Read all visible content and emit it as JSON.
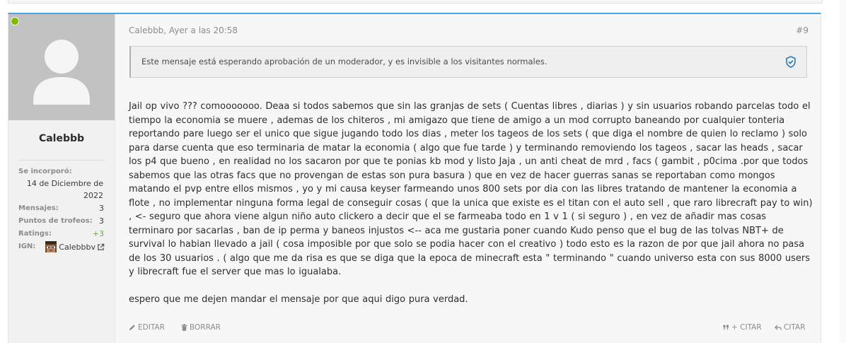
{
  "post": {
    "author": "Calebbb",
    "meta": "Calebbb, Ayer a las 20:58",
    "number": "#9",
    "notice": "Este mensaje está esperando aprobación de un moderador, y es invisible a los visitantes normales.",
    "body_p1": "Jail op vivo ??? comooooooo. Deaa si todos sabemos que sin las granjas de sets ( Cuentas libres , diarias ) y sin usuarios robando parcelas todo el tiempo la economia se muere , ademas de los chiteros , mi amigazo que tiene de amigo a un mod corrupto baneando por cualquier tonteria reportando pare luego ser el unico que sigue jugando todo los dias , meter los tageos de los sets ( que diga el nombre de quien lo reclamo ) solo para darse cuenta que eso terminaria de matar la economia ( algo que fue tarde ) y terminando removiendo los tageos , sacar las heads , sacar los p4 que bueno , en realidad no los sacaron por que te ponias kb mod y listo Jaja , un anti cheat de mrd , facs ( gambit , p0cima .por que todos sabemos que las otras facs que no provengan de estas son pura basura ) que en vez de hacer guerras sanas se reportaban como mongos matando el pvp entre ellos mismos , yo y mi causa keyser farmeando unos 800 sets por dia con las libres tratando de mantener la economia a flote , no implementar ninguna forma legal de conseguir cosas ( que la unica que existe es el titan con el auto sell , que raro librecraft pay to win) , <- seguro que ahora viene algun niño auto clickero a decir que el se farmeaba todo en 1 v 1 ( si seguro ) , en vez de añadir mas cosas terminaro por sacarlas , ban de ip perma y baneos injustos <-- aca me gustaria poner cuando Kudo penso que el bug de las tolvas NBT+ de survival lo habian llevado a jail ( cosa imposible por que solo se podia hacer con el creativo ) todo esto es la razon de por que jail ahora no pasa de los 30 usuarios . ( algo que me da risa es que se diga que la epoca de minecraft esta \" terminando \" cuando universo esta con sus 8000 users y librecraft fue el server que mas lo igualaba.",
    "body_p2": "espero que me dejen mandar el mensaje por que aqui digo pura verdad."
  },
  "user": {
    "name": "Calebbb",
    "joined_label": "Se incorporó:",
    "joined_value": "14 de Diciembre de 2022",
    "messages_label": "Mensajes:",
    "messages_value": "3",
    "trophies_label": "Puntos de trofeos:",
    "trophies_value": "3",
    "ratings_label": "Ratings:",
    "ratings_value": "+3",
    "ign_label": "IGN:",
    "ign_value": "Calebbbv"
  },
  "actions": {
    "edit": "EDITAR",
    "delete": "BORRAR",
    "quote_plus": "+ CITAR",
    "quote": "CITAR"
  },
  "colors": {
    "accent": "#47a7eb",
    "online": "#7fb900",
    "ratings": "#63b043",
    "shield": "#2577b1"
  }
}
